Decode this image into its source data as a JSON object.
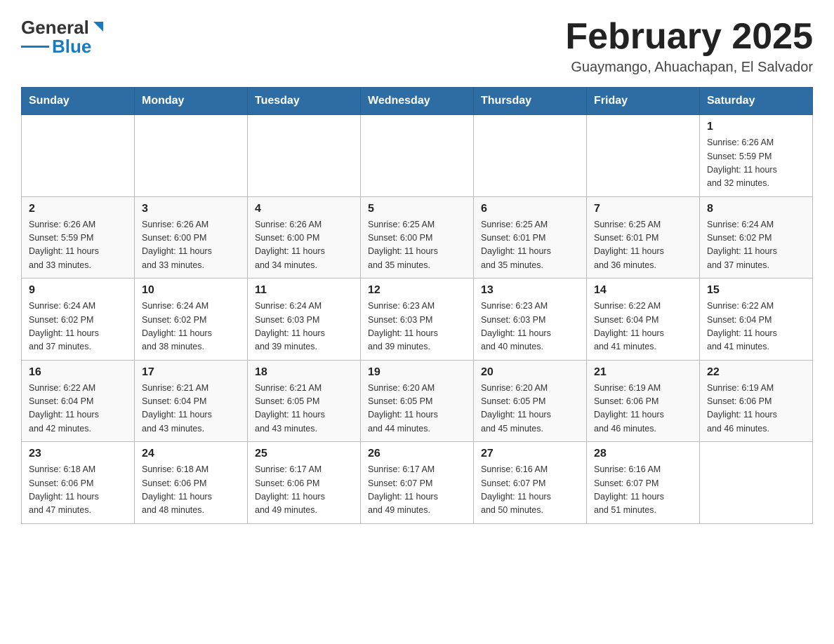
{
  "header": {
    "logo_general": "General",
    "logo_blue": "Blue",
    "title": "February 2025",
    "subtitle": "Guaymango, Ahuachapan, El Salvador"
  },
  "days_of_week": [
    "Sunday",
    "Monday",
    "Tuesday",
    "Wednesday",
    "Thursday",
    "Friday",
    "Saturday"
  ],
  "weeks": [
    {
      "days": [
        {
          "number": "",
          "info": ""
        },
        {
          "number": "",
          "info": ""
        },
        {
          "number": "",
          "info": ""
        },
        {
          "number": "",
          "info": ""
        },
        {
          "number": "",
          "info": ""
        },
        {
          "number": "",
          "info": ""
        },
        {
          "number": "1",
          "info": "Sunrise: 6:26 AM\nSunset: 5:59 PM\nDaylight: 11 hours\nand 32 minutes."
        }
      ]
    },
    {
      "days": [
        {
          "number": "2",
          "info": "Sunrise: 6:26 AM\nSunset: 5:59 PM\nDaylight: 11 hours\nand 33 minutes."
        },
        {
          "number": "3",
          "info": "Sunrise: 6:26 AM\nSunset: 6:00 PM\nDaylight: 11 hours\nand 33 minutes."
        },
        {
          "number": "4",
          "info": "Sunrise: 6:26 AM\nSunset: 6:00 PM\nDaylight: 11 hours\nand 34 minutes."
        },
        {
          "number": "5",
          "info": "Sunrise: 6:25 AM\nSunset: 6:00 PM\nDaylight: 11 hours\nand 35 minutes."
        },
        {
          "number": "6",
          "info": "Sunrise: 6:25 AM\nSunset: 6:01 PM\nDaylight: 11 hours\nand 35 minutes."
        },
        {
          "number": "7",
          "info": "Sunrise: 6:25 AM\nSunset: 6:01 PM\nDaylight: 11 hours\nand 36 minutes."
        },
        {
          "number": "8",
          "info": "Sunrise: 6:24 AM\nSunset: 6:02 PM\nDaylight: 11 hours\nand 37 minutes."
        }
      ]
    },
    {
      "days": [
        {
          "number": "9",
          "info": "Sunrise: 6:24 AM\nSunset: 6:02 PM\nDaylight: 11 hours\nand 37 minutes."
        },
        {
          "number": "10",
          "info": "Sunrise: 6:24 AM\nSunset: 6:02 PM\nDaylight: 11 hours\nand 38 minutes."
        },
        {
          "number": "11",
          "info": "Sunrise: 6:24 AM\nSunset: 6:03 PM\nDaylight: 11 hours\nand 39 minutes."
        },
        {
          "number": "12",
          "info": "Sunrise: 6:23 AM\nSunset: 6:03 PM\nDaylight: 11 hours\nand 39 minutes."
        },
        {
          "number": "13",
          "info": "Sunrise: 6:23 AM\nSunset: 6:03 PM\nDaylight: 11 hours\nand 40 minutes."
        },
        {
          "number": "14",
          "info": "Sunrise: 6:22 AM\nSunset: 6:04 PM\nDaylight: 11 hours\nand 41 minutes."
        },
        {
          "number": "15",
          "info": "Sunrise: 6:22 AM\nSunset: 6:04 PM\nDaylight: 11 hours\nand 41 minutes."
        }
      ]
    },
    {
      "days": [
        {
          "number": "16",
          "info": "Sunrise: 6:22 AM\nSunset: 6:04 PM\nDaylight: 11 hours\nand 42 minutes."
        },
        {
          "number": "17",
          "info": "Sunrise: 6:21 AM\nSunset: 6:04 PM\nDaylight: 11 hours\nand 43 minutes."
        },
        {
          "number": "18",
          "info": "Sunrise: 6:21 AM\nSunset: 6:05 PM\nDaylight: 11 hours\nand 43 minutes."
        },
        {
          "number": "19",
          "info": "Sunrise: 6:20 AM\nSunset: 6:05 PM\nDaylight: 11 hours\nand 44 minutes."
        },
        {
          "number": "20",
          "info": "Sunrise: 6:20 AM\nSunset: 6:05 PM\nDaylight: 11 hours\nand 45 minutes."
        },
        {
          "number": "21",
          "info": "Sunrise: 6:19 AM\nSunset: 6:06 PM\nDaylight: 11 hours\nand 46 minutes."
        },
        {
          "number": "22",
          "info": "Sunrise: 6:19 AM\nSunset: 6:06 PM\nDaylight: 11 hours\nand 46 minutes."
        }
      ]
    },
    {
      "days": [
        {
          "number": "23",
          "info": "Sunrise: 6:18 AM\nSunset: 6:06 PM\nDaylight: 11 hours\nand 47 minutes."
        },
        {
          "number": "24",
          "info": "Sunrise: 6:18 AM\nSunset: 6:06 PM\nDaylight: 11 hours\nand 48 minutes."
        },
        {
          "number": "25",
          "info": "Sunrise: 6:17 AM\nSunset: 6:06 PM\nDaylight: 11 hours\nand 49 minutes."
        },
        {
          "number": "26",
          "info": "Sunrise: 6:17 AM\nSunset: 6:07 PM\nDaylight: 11 hours\nand 49 minutes."
        },
        {
          "number": "27",
          "info": "Sunrise: 6:16 AM\nSunset: 6:07 PM\nDaylight: 11 hours\nand 50 minutes."
        },
        {
          "number": "28",
          "info": "Sunrise: 6:16 AM\nSunset: 6:07 PM\nDaylight: 11 hours\nand 51 minutes."
        },
        {
          "number": "",
          "info": ""
        }
      ]
    }
  ]
}
